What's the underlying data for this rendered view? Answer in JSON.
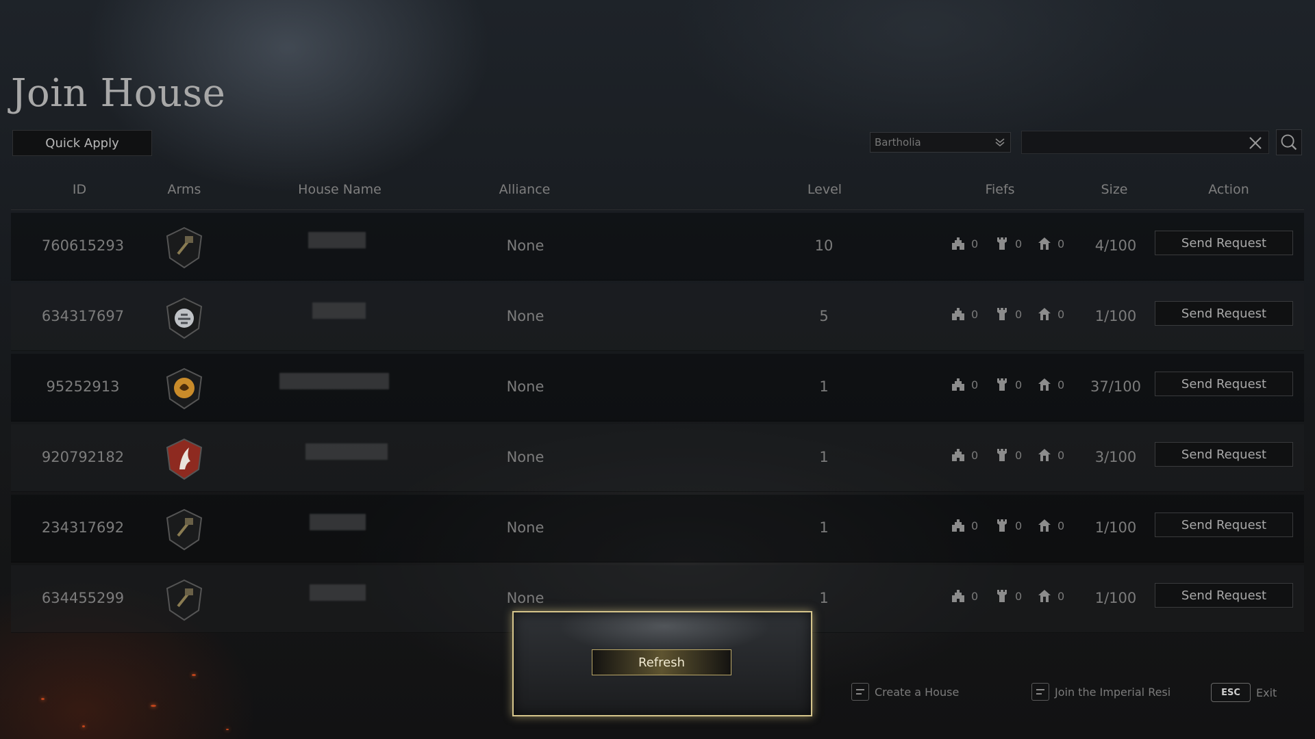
{
  "page": {
    "title": "Join House"
  },
  "toolbar": {
    "quick_apply": "Quick Apply",
    "region_selected": "Bartholia",
    "search_placeholder": ""
  },
  "table": {
    "columns": [
      "ID",
      "Arms",
      "House Name",
      "Alliance",
      "Level",
      "Fiefs",
      "Size",
      "Action"
    ],
    "rows": [
      {
        "id": "760615293",
        "arms": "dark-shield-banner-crest",
        "alliance": "None",
        "level": "10",
        "fief_a": "0",
        "fief_b": "0",
        "fief_c": "0",
        "size": "4/100",
        "action": "Send Request"
      },
      {
        "id": "634317697",
        "arms": "silver-beast-crest",
        "alliance": "None",
        "level": "5",
        "fief_a": "0",
        "fief_b": "0",
        "fief_c": "0",
        "size": "1/100",
        "action": "Send Request"
      },
      {
        "id": "95252913",
        "arms": "golden-dragon-crest",
        "alliance": "None",
        "level": "1",
        "fief_a": "0",
        "fief_b": "0",
        "fief_c": "0",
        "size": "37/100",
        "action": "Send Request"
      },
      {
        "id": "920792182",
        "arms": "red-white-wing-crest",
        "alliance": "None",
        "level": "1",
        "fief_a": "0",
        "fief_b": "0",
        "fief_c": "0",
        "size": "3/100",
        "action": "Send Request"
      },
      {
        "id": "234317692",
        "arms": "dark-shield-banner-crest",
        "alliance": "None",
        "level": "1",
        "fief_a": "0",
        "fief_b": "0",
        "fief_c": "0",
        "size": "1/100",
        "action": "Send Request"
      },
      {
        "id": "634455299",
        "arms": "dark-shield-banner-crest",
        "alliance": "None",
        "level": "1",
        "fief_a": "0",
        "fief_b": "0",
        "fief_c": "0",
        "size": "1/100",
        "action": "Send Request"
      }
    ]
  },
  "modal": {
    "refresh_label": "Refresh"
  },
  "footer": {
    "create_house": "Create a House",
    "join_imperial": "Join the Imperial Resi",
    "esc_key": "ESC",
    "exit": "Exit"
  },
  "colors": {
    "modal_border": "#d7c68c",
    "ember": "#c2451c",
    "crest_red": "#8e2a20",
    "crest_gold": "#c98b2a"
  }
}
